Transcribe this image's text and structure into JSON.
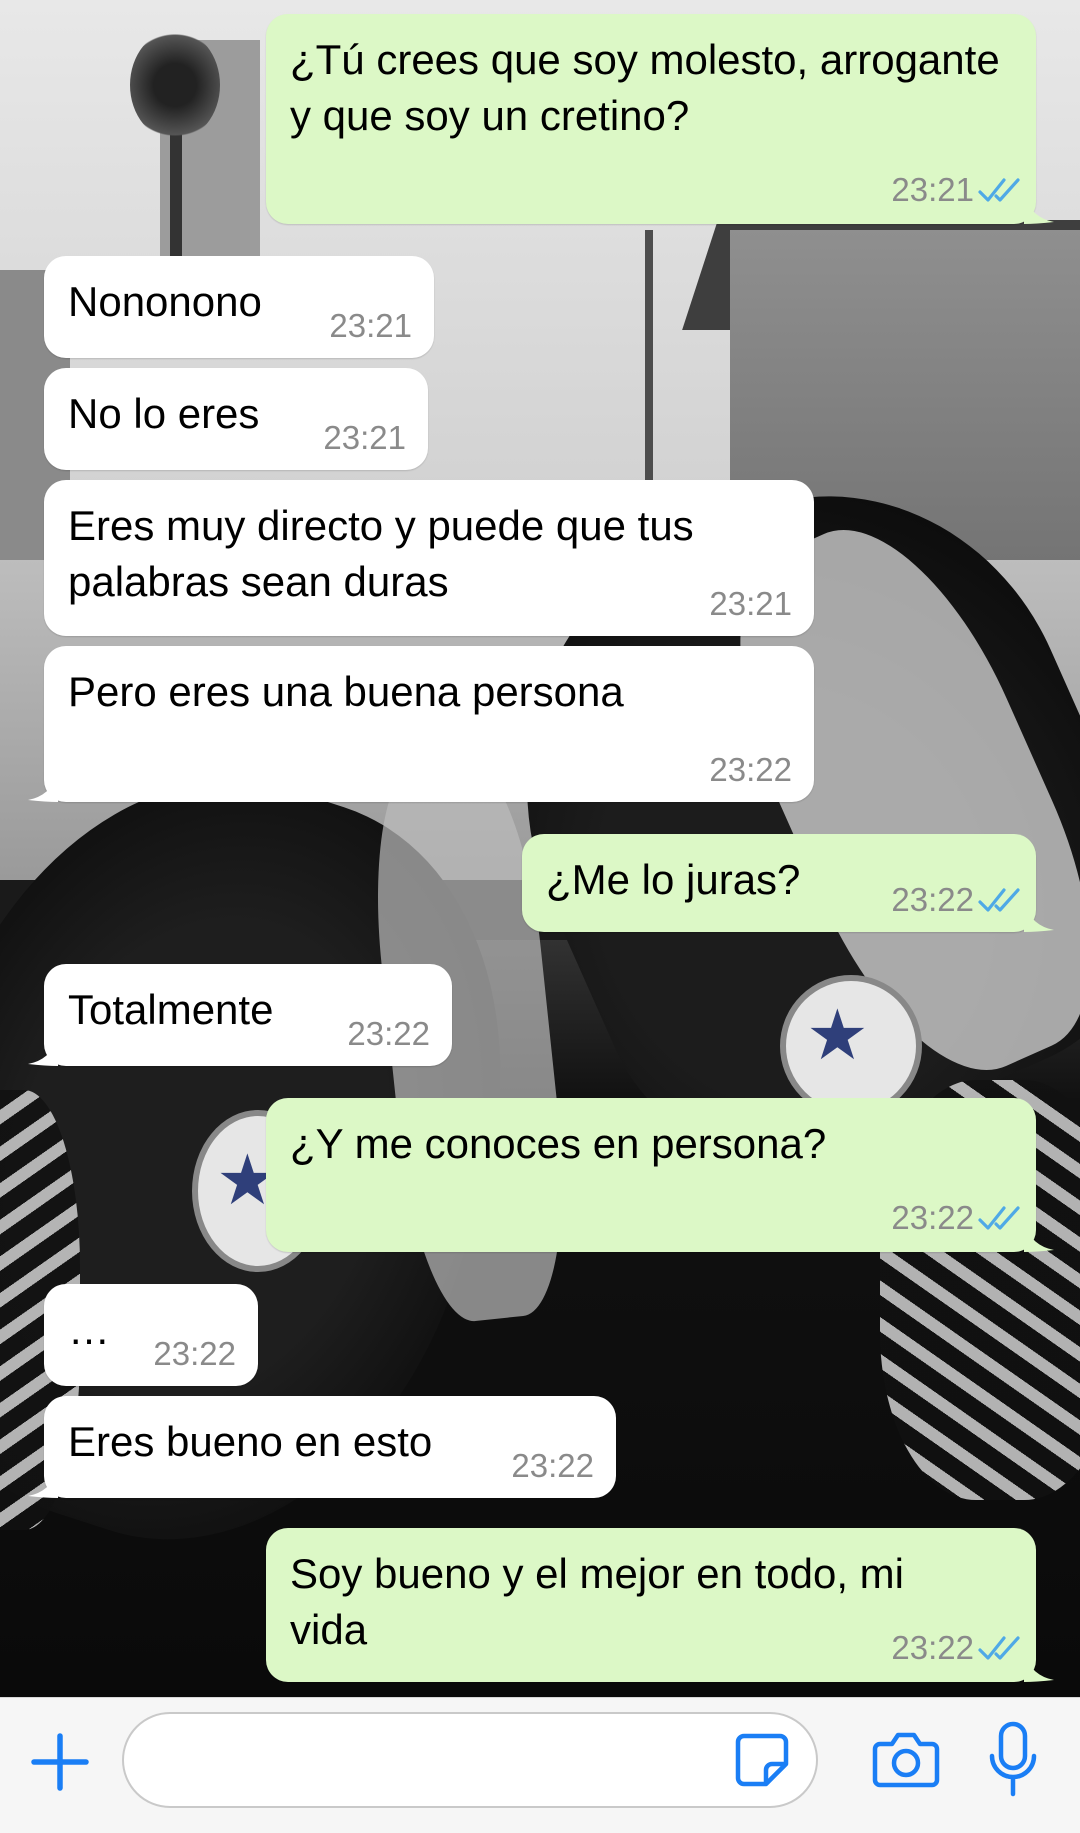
{
  "colors": {
    "incoming_bubble": "#ffffff",
    "outgoing_bubble": "#dcf8c6",
    "read_ticks": "#4fa9e6",
    "accent_icons": "#1a7ef5",
    "timestamp": "#8a8a8a"
  },
  "messages": [
    {
      "direction": "out",
      "text": "¿Tú crees que soy molesto, arrogante y que soy un cretino?",
      "time": "23:21",
      "status": "read"
    },
    {
      "direction": "in",
      "text": "Nononono",
      "time": "23:21"
    },
    {
      "direction": "in",
      "text": "No lo eres",
      "time": "23:21"
    },
    {
      "direction": "in",
      "text": "Eres muy directo y puede que tus palabras sean duras",
      "time": "23:21"
    },
    {
      "direction": "in",
      "text": "Pero eres una buena persona",
      "time": "23:22"
    },
    {
      "direction": "out",
      "text": "¿Me lo juras?",
      "time": "23:22",
      "status": "read"
    },
    {
      "direction": "in",
      "text": "Totalmente",
      "time": "23:22"
    },
    {
      "direction": "out",
      "text": "¿Y me conoces en persona?",
      "time": "23:22",
      "status": "read"
    },
    {
      "direction": "in",
      "text": "…",
      "time": "23:22"
    },
    {
      "direction": "in",
      "text": "Eres bueno en esto",
      "time": "23:22"
    },
    {
      "direction": "out",
      "text": "Soy bueno y el mejor en todo, mi vida",
      "time": "23:22",
      "status": "read"
    }
  ],
  "input_bar": {
    "message_value": "",
    "icons": [
      "plus-icon",
      "sticker-icon",
      "camera-icon",
      "microphone-icon"
    ]
  }
}
